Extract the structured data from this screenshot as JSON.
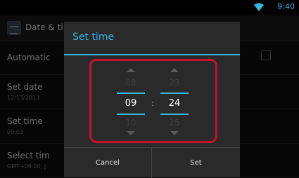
{
  "status_bar": {
    "time": "9:40",
    "icon": "wifi-icon",
    "accent": "#33b5e5"
  },
  "action_bar": {
    "title": "Date & ti",
    "icon": "settings-icon"
  },
  "settings_list": [
    {
      "title": "Automatic",
      "subtitle": ""
    },
    {
      "title": "Set date",
      "subtitle": "12/13/2013"
    },
    {
      "title": "Set time",
      "subtitle": "09:03"
    },
    {
      "title": "Select tim",
      "subtitle": "GMT+09:00, J"
    }
  ],
  "dialog": {
    "title": "Set time",
    "hour": {
      "prev": "08",
      "current": "09",
      "next": "10"
    },
    "minute": {
      "prev": "23",
      "current": "24",
      "next": "25"
    },
    "separator": ":",
    "buttons": {
      "cancel": "Cancel",
      "set": "Set"
    }
  },
  "colors": {
    "accent": "#33b5e5",
    "highlight": "#c8102e"
  }
}
